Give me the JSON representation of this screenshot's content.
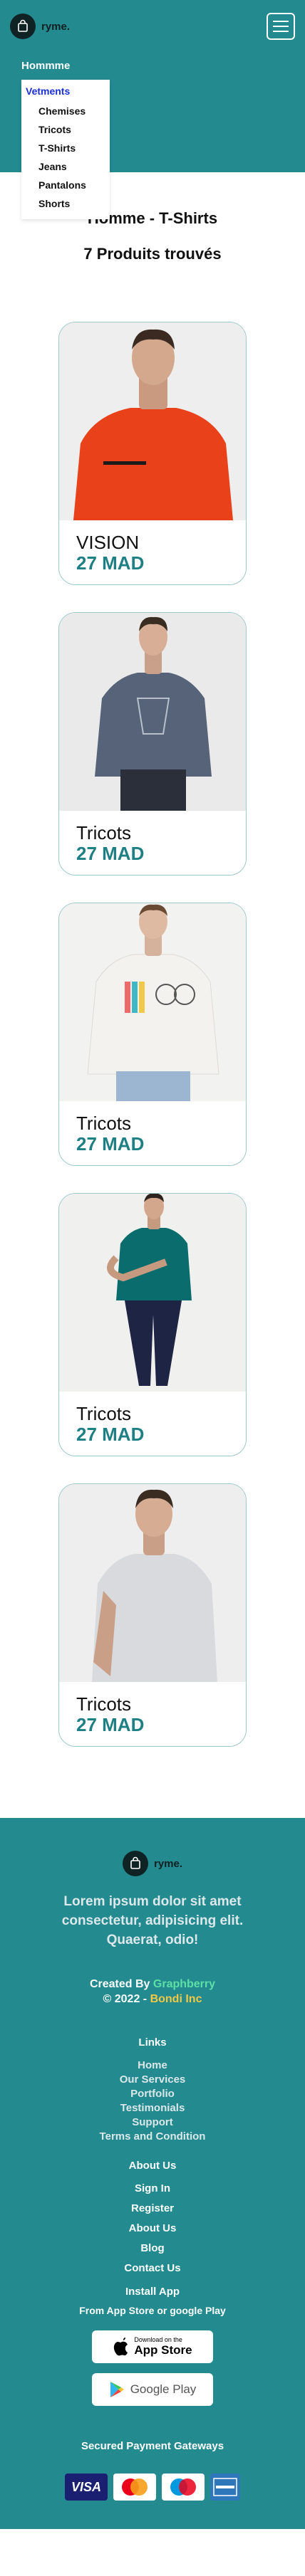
{
  "header": {
    "brand_name": "ryme.",
    "menu_toggle": "menu"
  },
  "nav": {
    "home": "Hommme",
    "dropdown_title": "Vetments",
    "items": [
      "Chemises",
      "Tricots",
      "T-Shirts",
      "Jeans",
      "Pantalons",
      "Shorts"
    ]
  },
  "main": {
    "page_title": "Homme - T-Shirts",
    "count": "7 Produits trouvés"
  },
  "products": [
    {
      "name": "VISION",
      "price": "27 MAD",
      "shirt_color": "#e9421a",
      "pants_color": "#1b1b1b"
    },
    {
      "name": "Tricots",
      "price": "27 MAD",
      "shirt_color": "#566379",
      "pants_color": "#2b2f39"
    },
    {
      "name": "Tricots",
      "price": "27 MAD",
      "shirt_color": "#f4f2ee",
      "pants_color": "#9cb6d1"
    },
    {
      "name": "Tricots",
      "price": "27 MAD",
      "shirt_color": "#0b6c6d",
      "pants_color": "#1d2444"
    },
    {
      "name": "Tricots",
      "price": "27 MAD",
      "shirt_color": "#d8dadd",
      "pants_color": "#1b1b1b"
    }
  ],
  "footer": {
    "brand_name": "ryme.",
    "lorem": "Lorem ipsum dolor sit amet consectetur, adipisicing elit. Quaerat, odio!",
    "created_by": "Created By",
    "created_by_name": "Graphberry",
    "year": "© 2022 -",
    "year_name": "Bondi Inc",
    "links_title": "Links",
    "links": [
      "Home",
      "Our Services",
      "Portfolio",
      "Testimonials",
      "Support",
      "Terms and Condition"
    ],
    "about_title": "About Us",
    "about": [
      "Sign In",
      "Register",
      "About Us",
      "Blog",
      "Contact Us"
    ],
    "install_title": "Install App",
    "install_sub": "From App Store or google Play",
    "app_store_small": "Download on the",
    "app_store_big": "App Store",
    "google_play": "Google Play",
    "payments_title": "Secured Payment Gateways",
    "payments": [
      "VISA",
      "MasterCard",
      "Maestro",
      "AMERICAN EXPRESS"
    ]
  },
  "colors": {
    "teal": "#238a8f",
    "price": "#1e7f84",
    "accent_green": "#5de0a5",
    "accent_yellow": "#f5c842"
  }
}
